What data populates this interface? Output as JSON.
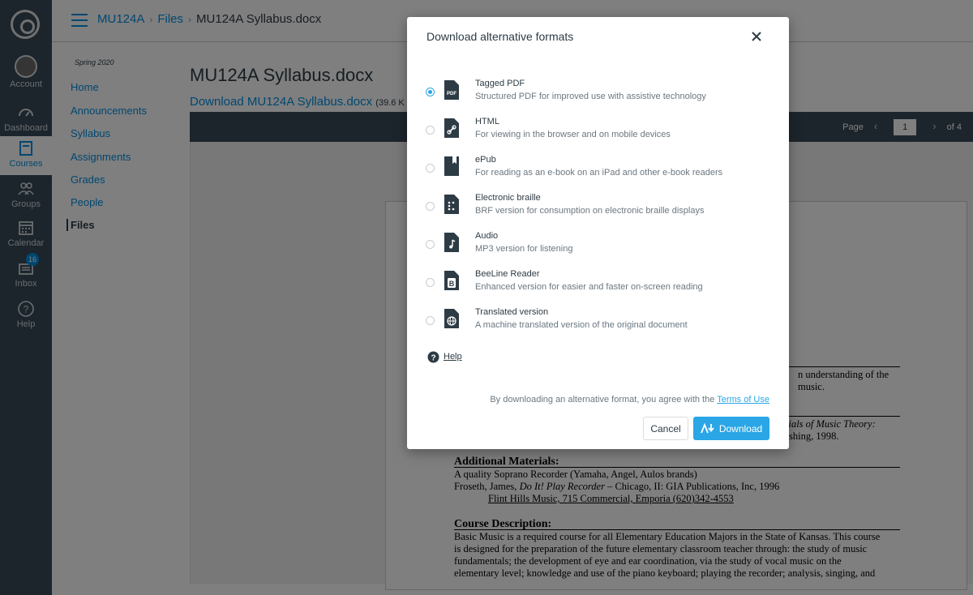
{
  "global_nav": {
    "items": [
      {
        "label": "Account",
        "icon": "user-avatar"
      },
      {
        "label": "Dashboard",
        "icon": "speedometer-icon"
      },
      {
        "label": "Courses",
        "icon": "book-icon"
      },
      {
        "label": "Groups",
        "icon": "people-icon"
      },
      {
        "label": "Calendar",
        "icon": "calendar-icon"
      },
      {
        "label": "Inbox",
        "icon": "inbox-icon",
        "badge": "16"
      },
      {
        "label": "Help",
        "icon": "question-icon"
      }
    ]
  },
  "breadcrumb": {
    "course": "MU124A",
    "files": "Files",
    "current": "MU124A Syllabus.docx"
  },
  "course_nav": {
    "term": "Spring 2020",
    "items": [
      "Home",
      "Announcements",
      "Syllabus",
      "Assignments",
      "Grades",
      "People",
      "Files"
    ]
  },
  "content": {
    "title": "MU124A Syllabus.docx",
    "download_link": "Download MU124A Syllabus.docx",
    "download_size": "(39.6 K",
    "pager": {
      "label": "Page",
      "current": "1",
      "total": "of 4"
    }
  },
  "document": {
    "line1": "n understanding of the",
    "line2": "music.",
    "line3": "tials of Music Theory:",
    "line4": "shing, 1998.",
    "additional_heading": "Additional Materials:",
    "add1": "A quality Soprano Recorder (Yamaha, Angel, Aulos brands)",
    "add2_pre": "Froseth, James, ",
    "add2_italic": "Do It! Play Recorder",
    "add2_post": " – Chicago, II: GIA Publications, Inc, 1996",
    "add3": "Flint Hills Music, 715 Commercial, Emporia (620)342-4553",
    "desc_heading": "Course Description:",
    "desc1": "Basic Music is a required course for all Elementary Education Majors in the State of Kansas. This course",
    "desc2": "is designed for the preparation of the future elementary classroom teacher through: the study of music",
    "desc3": "fundamentals; the development of eye and ear coordination, via the study of vocal music on the",
    "desc4": "elementary level; knowledge and use of the piano keyboard; playing the recorder; analysis, singing, and"
  },
  "modal": {
    "title": "Download alternative formats",
    "options": [
      {
        "name": "Tagged PDF",
        "desc": "Structured PDF for improved use with assistive technology",
        "icon": "pdf-file-icon",
        "selected": true,
        "icon_label": "PDF"
      },
      {
        "name": "HTML",
        "desc": "For viewing in the browser and on mobile devices",
        "icon": "html-link-file-icon",
        "selected": false
      },
      {
        "name": "ePub",
        "desc": "For reading as an e-book on an iPad and other e-book readers",
        "icon": "epub-bookmark-file-icon",
        "selected": false
      },
      {
        "name": "Electronic braille",
        "desc": "BRF version for consumption on electronic braille displays",
        "icon": "braille-file-icon",
        "selected": false
      },
      {
        "name": "Audio",
        "desc": "MP3 version for listening",
        "icon": "audio-note-file-icon",
        "selected": false
      },
      {
        "name": "BeeLine Reader",
        "desc": "Enhanced version for easier and faster on-screen reading",
        "icon": "beeline-file-icon",
        "selected": false,
        "icon_label": "B"
      },
      {
        "name": "Translated version",
        "desc": "A machine translated version of the original document",
        "icon": "globe-file-icon",
        "selected": false
      }
    ],
    "help_label": "Help",
    "terms_text": "By downloading an alternative format, you agree with the ",
    "terms_link": "Terms of Use",
    "cancel_label": "Cancel",
    "download_label": "Download"
  },
  "colors": {
    "accent": "#2aa6e6",
    "canvas_link": "#008ee2",
    "nav_bg": "#394b58",
    "viewer_bar": "#3a4b58"
  }
}
